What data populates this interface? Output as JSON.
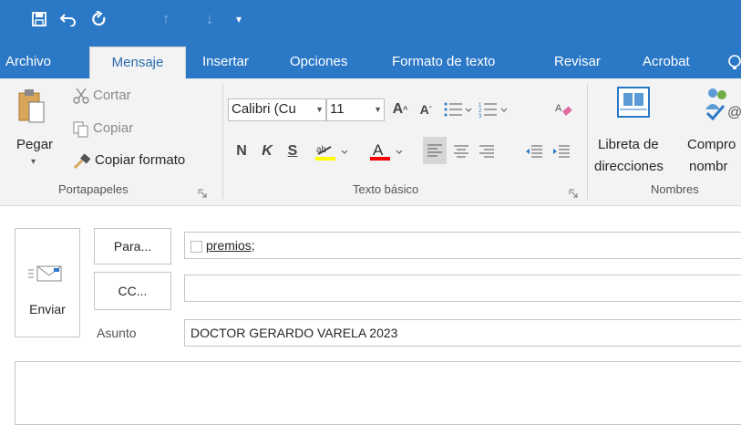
{
  "tabs": [
    "Archivo",
    "Mensaje",
    "Insertar",
    "Opciones",
    "Formato de texto",
    "Revisar",
    "Acrobat"
  ],
  "clipboard": {
    "paste": "Pegar",
    "cut": "Cortar",
    "copy": "Copiar",
    "format_painter": "Copiar formato",
    "group_label": "Portapapeles"
  },
  "basic_text": {
    "font_name": "Calibri (Cu",
    "font_size": "11",
    "bold": "N",
    "italic": "K",
    "underline": "S",
    "group_label": "Texto básico"
  },
  "names": {
    "address_book_line1": "Libreta de",
    "address_book_line2": "direcciones",
    "check_names_line1": "Compro",
    "check_names_line2": "nombr",
    "group_label": "Nombres"
  },
  "compose": {
    "send_label": "Enviar",
    "to_button": "Para...",
    "cc_button": "CC...",
    "subject_label": "Asunto",
    "to_value": "premios;",
    "cc_value": "",
    "subject_value": "DOCTOR GERARDO VARELA 2023"
  },
  "colors": {
    "accent": "#2b78c6",
    "highlight": "#ffff00",
    "font_color": "#ff0000"
  }
}
